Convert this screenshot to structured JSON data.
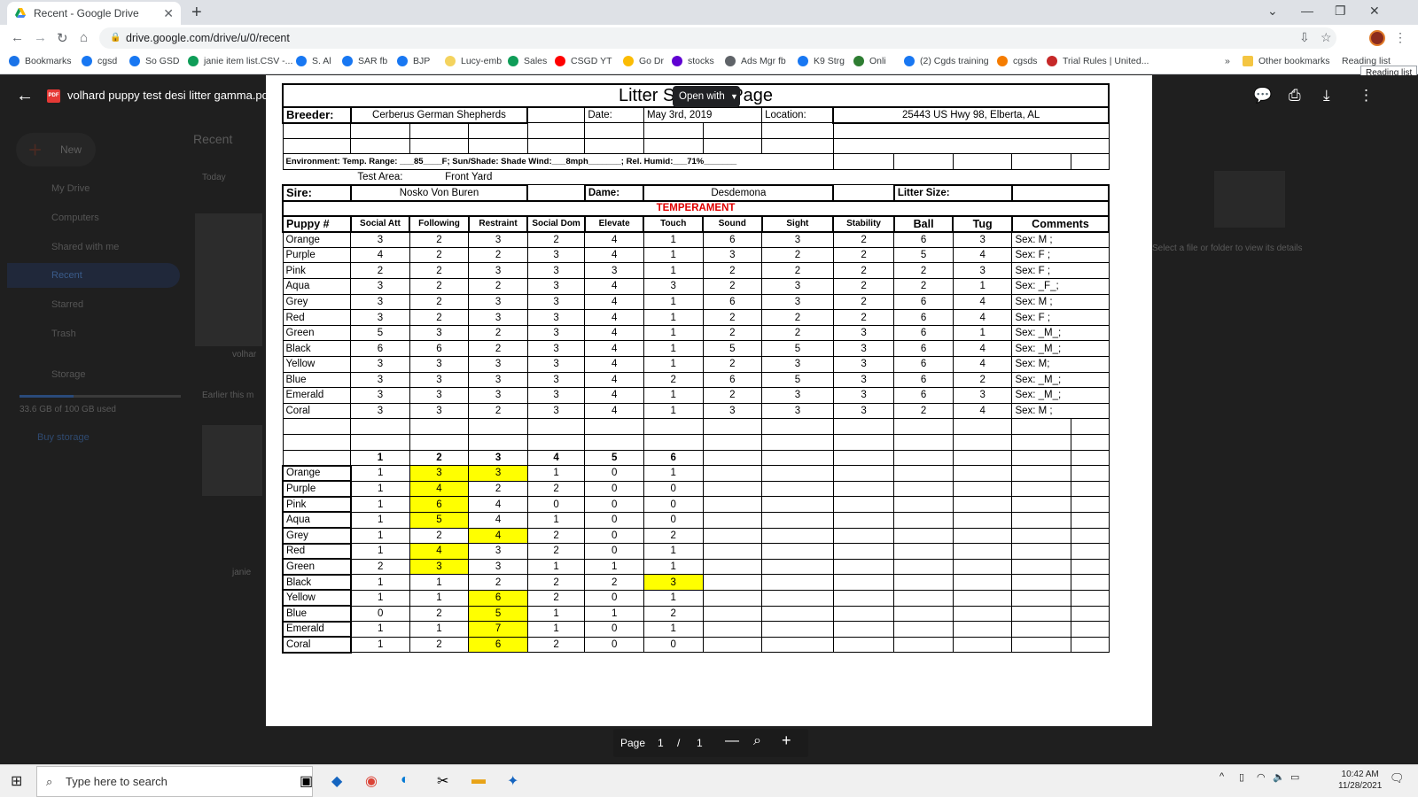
{
  "browser": {
    "tab_title": "Recent - Google Drive",
    "url": "drive.google.com/drive/u/0/recent",
    "tooltip": "Reading list",
    "bookmarks": [
      {
        "label": "Bookmarks",
        "color": "#1a73e8"
      },
      {
        "label": "cgsd",
        "color": "#1877f2"
      },
      {
        "label": "So GSD",
        "color": "#1877f2"
      },
      {
        "label": "janie item list.CSV -...",
        "color": "#0f9d58"
      },
      {
        "label": "S. Al",
        "color": "#1877f2"
      },
      {
        "label": "SAR fb",
        "color": "#1877f2"
      },
      {
        "label": "BJP",
        "color": "#1877f2"
      },
      {
        "label": "Lucy-emb",
        "color": "#f4d35e"
      },
      {
        "label": "Sales",
        "color": "#0f9d58"
      },
      {
        "label": "CSGD YT",
        "color": "#ff0000"
      },
      {
        "label": "Go Dr",
        "color": "#fbbc04"
      },
      {
        "label": "stocks",
        "color": "#6001d2"
      },
      {
        "label": "Ads Mgr fb",
        "color": "#5f6368"
      },
      {
        "label": "K9 Strg",
        "color": "#1877f2"
      },
      {
        "label": "Onli",
        "color": "#2e7d32"
      },
      {
        "label": "(2) Cgds training",
        "color": "#1877f2"
      },
      {
        "label": "cgsds",
        "color": "#f57c00"
      },
      {
        "label": "Trial Rules | United...",
        "color": "#c62828"
      }
    ],
    "other_bookmarks": "Other bookmarks",
    "reading_list": "Reading list"
  },
  "drive": {
    "new_label": "New",
    "page_title": "Recent",
    "section_today": "Today",
    "section_earlier": "Earlier this m",
    "sidebar": [
      {
        "label": "My Drive"
      },
      {
        "label": "Computers"
      },
      {
        "label": "Shared with me"
      },
      {
        "label": "Recent"
      },
      {
        "label": "Starred"
      },
      {
        "label": "Trash"
      },
      {
        "label": "Storage"
      }
    ],
    "storage_text": "33.6 GB of 100 GB used",
    "storage_fraction": 0.336,
    "buy_storage": "Buy storage",
    "details_hint": "Select a file or folder to view its details",
    "thumb_label_1": "volhar",
    "thumb_label_2": "janie"
  },
  "viewer": {
    "filename": "volhard puppy test desi litter gamma.pdf",
    "open_with": "Open with",
    "page_label": "Page",
    "page_current": "1",
    "page_sep": "/",
    "page_total": "1"
  },
  "doc": {
    "title_left": "Litter S",
    "title_right": "Page",
    "breeder_label": "Breeder:",
    "breeder": "Cerberus German Shepherds",
    "date_label": "Date:",
    "date": "May 3rd, 2019",
    "location_label": "Location:",
    "location": "25443 US Hwy 98, Elberta, AL",
    "environment": "Environment:    Temp. Range: ___85____F;  Sun/Shade:  Shade   Wind:___8mph_______;    Rel. Humid:___71%_______",
    "test_area_label": "Test Area:",
    "test_area": "Front Yard",
    "sire_label": "Sire:",
    "sire": "Nosko Von Buren",
    "dame_label": "Dame:",
    "dame": "Desdemona",
    "litter_size_label": "Litter Size:",
    "temperament": "TEMPERAMENT",
    "headers": [
      "Puppy #",
      "Social Att",
      "Following",
      "Restraint",
      "Social Dom",
      "Elevate",
      "Touch",
      "Sound",
      "Sight",
      "Stability",
      "Ball",
      "Tug",
      "Comments"
    ],
    "puppies": [
      {
        "name": "Orange",
        "scores": [
          "3",
          "2",
          "3",
          "2",
          "4",
          "1",
          "6",
          "3",
          "2",
          "6",
          "3"
        ],
        "comment": "Sex:   M  ;"
      },
      {
        "name": "Purple",
        "scores": [
          "4",
          "2",
          "2",
          "3",
          "4",
          "1",
          "3",
          "2",
          "2",
          "5",
          "4"
        ],
        "comment": "Sex:   F  ;"
      },
      {
        "name": "Pink",
        "scores": [
          "2",
          "2",
          "3",
          "3",
          "3",
          "1",
          "2",
          "2",
          "2",
          "2",
          "3"
        ],
        "comment": "Sex:   F  ;"
      },
      {
        "name": "Aqua",
        "scores": [
          "3",
          "2",
          "2",
          "3",
          "4",
          "3",
          "2",
          "3",
          "2",
          "2",
          "1"
        ],
        "comment": "Sex:  _F_;"
      },
      {
        "name": "Grey",
        "scores": [
          "3",
          "2",
          "3",
          "3",
          "4",
          "1",
          "6",
          "3",
          "2",
          "6",
          "4"
        ],
        "comment": "Sex:   M  ;"
      },
      {
        "name": "Red",
        "scores": [
          "3",
          "2",
          "3",
          "3",
          "4",
          "1",
          "2",
          "2",
          "2",
          "6",
          "4"
        ],
        "comment": "Sex:   F  ;"
      },
      {
        "name": "Green",
        "scores": [
          "5",
          "3",
          "2",
          "3",
          "4",
          "1",
          "2",
          "2",
          "3",
          "6",
          "1"
        ],
        "comment": "Sex:  _M_;"
      },
      {
        "name": "Black",
        "scores": [
          "6",
          "6",
          "2",
          "3",
          "4",
          "1",
          "5",
          "5",
          "3",
          "6",
          "4"
        ],
        "comment": "Sex:  _M_;"
      },
      {
        "name": "Yellow",
        "scores": [
          "3",
          "3",
          "3",
          "3",
          "4",
          "1",
          "2",
          "3",
          "3",
          "6",
          "4"
        ],
        "comment": "Sex:   M;"
      },
      {
        "name": "Blue",
        "scores": [
          "3",
          "3",
          "3",
          "3",
          "4",
          "2",
          "6",
          "5",
          "3",
          "6",
          "2"
        ],
        "comment": "Sex:  _M_;"
      },
      {
        "name": "Emerald",
        "scores": [
          "3",
          "3",
          "3",
          "3",
          "4",
          "1",
          "2",
          "3",
          "3",
          "6",
          "3"
        ],
        "comment": "Sex:  _M_;"
      },
      {
        "name": "Coral",
        "scores": [
          "3",
          "3",
          "2",
          "3",
          "4",
          "1",
          "3",
          "3",
          "3",
          "2",
          "4"
        ],
        "comment": "Sex:   M  ;"
      }
    ],
    "tally_headers": [
      "1",
      "2",
      "3",
      "4",
      "5",
      "6"
    ],
    "tally": [
      {
        "name": "Orange",
        "counts": [
          "1",
          "3",
          "3",
          "1",
          "0",
          "1"
        ],
        "hl": [
          1,
          2
        ]
      },
      {
        "name": "Purple",
        "counts": [
          "1",
          "4",
          "2",
          "2",
          "0",
          "0"
        ],
        "hl": [
          1
        ]
      },
      {
        "name": "Pink",
        "counts": [
          "1",
          "6",
          "4",
          "0",
          "0",
          "0"
        ],
        "hl": [
          1
        ]
      },
      {
        "name": "Aqua",
        "counts": [
          "1",
          "5",
          "4",
          "1",
          "0",
          "0"
        ],
        "hl": [
          1
        ]
      },
      {
        "name": "Grey",
        "counts": [
          "1",
          "2",
          "4",
          "2",
          "0",
          "2"
        ],
        "hl": [
          2
        ]
      },
      {
        "name": "Red",
        "counts": [
          "1",
          "4",
          "3",
          "2",
          "0",
          "1"
        ],
        "hl": [
          1
        ]
      },
      {
        "name": "Green",
        "counts": [
          "2",
          "3",
          "3",
          "1",
          "1",
          "1"
        ],
        "hl": [
          1
        ]
      },
      {
        "name": "Black",
        "counts": [
          "1",
          "1",
          "2",
          "2",
          "2",
          "3"
        ],
        "hl": [
          5
        ]
      },
      {
        "name": "Yellow",
        "counts": [
          "1",
          "1",
          "6",
          "2",
          "0",
          "1"
        ],
        "hl": [
          2
        ]
      },
      {
        "name": "Blue",
        "counts": [
          "0",
          "2",
          "5",
          "1",
          "1",
          "2"
        ],
        "hl": [
          2
        ]
      },
      {
        "name": "Emerald",
        "counts": [
          "1",
          "1",
          "7",
          "1",
          "0",
          "1"
        ],
        "hl": [
          2
        ]
      },
      {
        "name": "Coral",
        "counts": [
          "1",
          "2",
          "6",
          "2",
          "0",
          "0"
        ],
        "hl": [
          2
        ]
      }
    ],
    "highlight_color": "#ffff00"
  },
  "taskbar": {
    "search_placeholder": "Type here to search",
    "time": "10:42 AM",
    "date": "11/28/2021"
  }
}
